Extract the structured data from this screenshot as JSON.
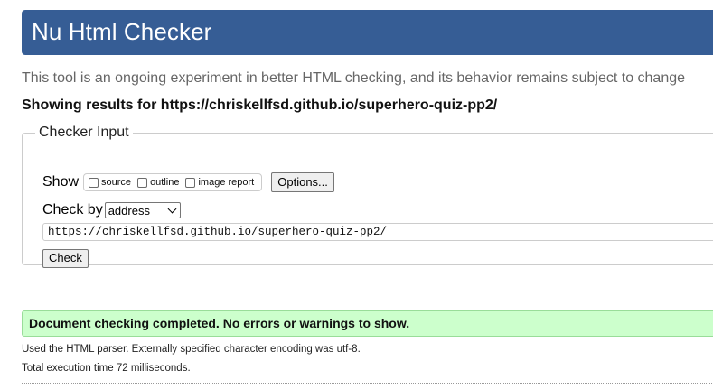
{
  "header": {
    "title": "Nu Html Checker"
  },
  "subtitle": "This tool is an ongoing experiment in better HTML checking, and its behavior remains subject to change",
  "results_heading": "Showing results for https://chriskellfsd.github.io/superhero-quiz-pp2/",
  "checker_input": {
    "legend": "Checker Input",
    "show_label": "Show",
    "show_options": [
      {
        "label": "source",
        "checked": false
      },
      {
        "label": "outline",
        "checked": false
      },
      {
        "label": "image report",
        "checked": false
      }
    ],
    "options_button": "Options...",
    "check_by_label": "Check by",
    "check_by_selected": "address",
    "url_value": "https://chriskellfsd.github.io/superhero-quiz-pp2/",
    "check_button": "Check"
  },
  "result": {
    "success_message": "Document checking completed. No errors or warnings to show.",
    "parser_note": "Used the HTML parser. Externally specified character encoding was utf-8.",
    "execution_time": "Total execution time 72 milliseconds."
  },
  "colors": {
    "banner": "#365d95",
    "success_bg": "#ccffcc"
  }
}
